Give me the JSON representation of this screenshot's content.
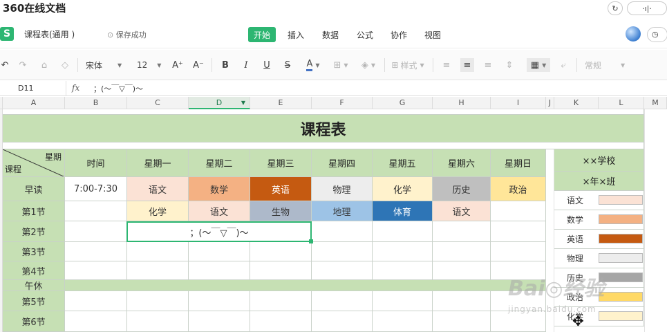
{
  "browser": {
    "title": "360在线文档",
    "refresh_icon": "refresh-icon",
    "audio_label": "·ı|·"
  },
  "app": {
    "doc_name": "课程表(通用 )",
    "save_status": "保存成功",
    "menu": [
      "开始",
      "插入",
      "数据",
      "公式",
      "协作",
      "视图"
    ],
    "active_menu": "开始"
  },
  "toolbar": {
    "font_name": "宋体",
    "font_size": "12",
    "styles_label": "样式",
    "normal_label": "常规"
  },
  "formula_bar": {
    "cell_ref": "D11",
    "fx": "fx",
    "content": "；(～￣▽￣)～"
  },
  "columns": [
    "A",
    "B",
    "C",
    "D",
    "E",
    "F",
    "G",
    "H",
    "I",
    "J",
    "K",
    "L",
    "M"
  ],
  "sheet": {
    "title": "课程表",
    "corner_top": "星期",
    "corner_bottom": "课程",
    "time_header": "时间",
    "days": [
      "星期一",
      "星期二",
      "星期三",
      "星期四",
      "星期五",
      "星期六",
      "星期日"
    ],
    "rows": [
      {
        "label": "早读",
        "time": "7:00-7:30",
        "cells": [
          "语文",
          "数学",
          "英语",
          "物理",
          "化学",
          "历史",
          "政治"
        ]
      },
      {
        "label": "第1节",
        "time": "",
        "cells": [
          "化学",
          "语文",
          "生物",
          "地理",
          "体育",
          "语文",
          ""
        ]
      },
      {
        "label": "第2节",
        "time": "",
        "cells": [
          "",
          "",
          "",
          "",
          "",
          "",
          ""
        ]
      },
      {
        "label": "第3节",
        "time": "",
        "cells": [
          "",
          "",
          "",
          "",
          "",
          "",
          ""
        ]
      },
      {
        "label": "第4节",
        "time": "",
        "cells": [
          "",
          "",
          "",
          "",
          "",
          "",
          ""
        ]
      },
      {
        "label": "午休",
        "time": "",
        "cells": []
      },
      {
        "label": "第5节",
        "time": "",
        "cells": [
          "",
          "",
          "",
          "",
          "",
          "",
          ""
        ]
      },
      {
        "label": "第6节",
        "time": "",
        "cells": [
          "",
          "",
          "",
          "",
          "",
          "",
          ""
        ]
      }
    ],
    "active_cell_text": "；(～￣▽￣)～",
    "school": "××学校",
    "class_name": "×年×班",
    "legend": [
      {
        "subject": "语文",
        "color": "#fbe2d5"
      },
      {
        "subject": "数学",
        "color": "#f4b183"
      },
      {
        "subject": "英语",
        "color": "#c55a11"
      },
      {
        "subject": "物理",
        "color": "#ededed"
      },
      {
        "subject": "历史",
        "color": "#a6a6a6"
      },
      {
        "subject": "政治",
        "color": "#ffd966"
      },
      {
        "subject": "化学",
        "color": "#fff2cc"
      }
    ]
  },
  "subject_colors": {
    "语文": "#fbe2d5",
    "数学": "#f4b183",
    "英语": "#c55a11",
    "物理": "#ededed",
    "化学": "#fff2cc",
    "历史": "#bfbfbf",
    "政治": "#ffe699",
    "生物": "#adb9ca",
    "地理": "#9dc3e6",
    "体育": "#2e75b6"
  },
  "watermark": {
    "main": "Bai◎经验",
    "sub": "jingyan.baidu.com"
  }
}
